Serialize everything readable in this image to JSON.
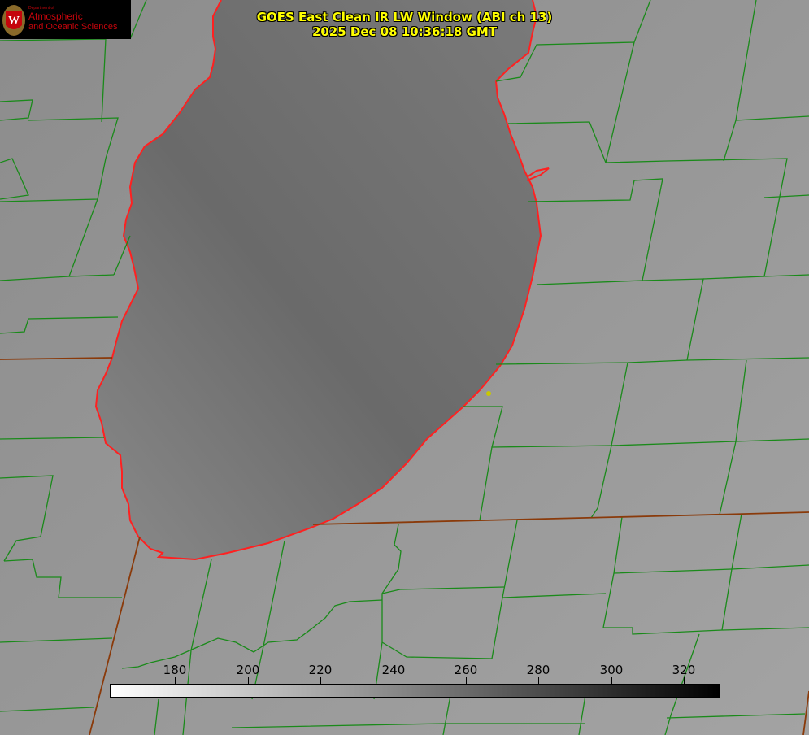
{
  "title_line1": "GOES East Clean IR LW Window (ABI ch 13)",
  "title_line2": "2025 Dec 08 10:36:18 GMT",
  "logo": {
    "dept_small": "Department of",
    "dept_line1": "Atmospheric",
    "dept_line2": "and Oceanic Sciences"
  },
  "colorbar": {
    "tick_labels": [
      "180",
      "200",
      "220",
      "240",
      "260",
      "280",
      "300",
      "320"
    ],
    "tick_values": [
      180,
      200,
      220,
      240,
      260,
      280,
      300,
      320
    ],
    "range": [
      162,
      330
    ],
    "gradient": [
      "#ffffff",
      "#000000"
    ]
  },
  "colors": {
    "county_lines": "#1a8a1a",
    "state_lines": "#8a3a0a",
    "shoreline": "#ff2020",
    "title_text": "#ffff00",
    "land": "#9a9a9a",
    "lake": "#6e6e6e"
  }
}
